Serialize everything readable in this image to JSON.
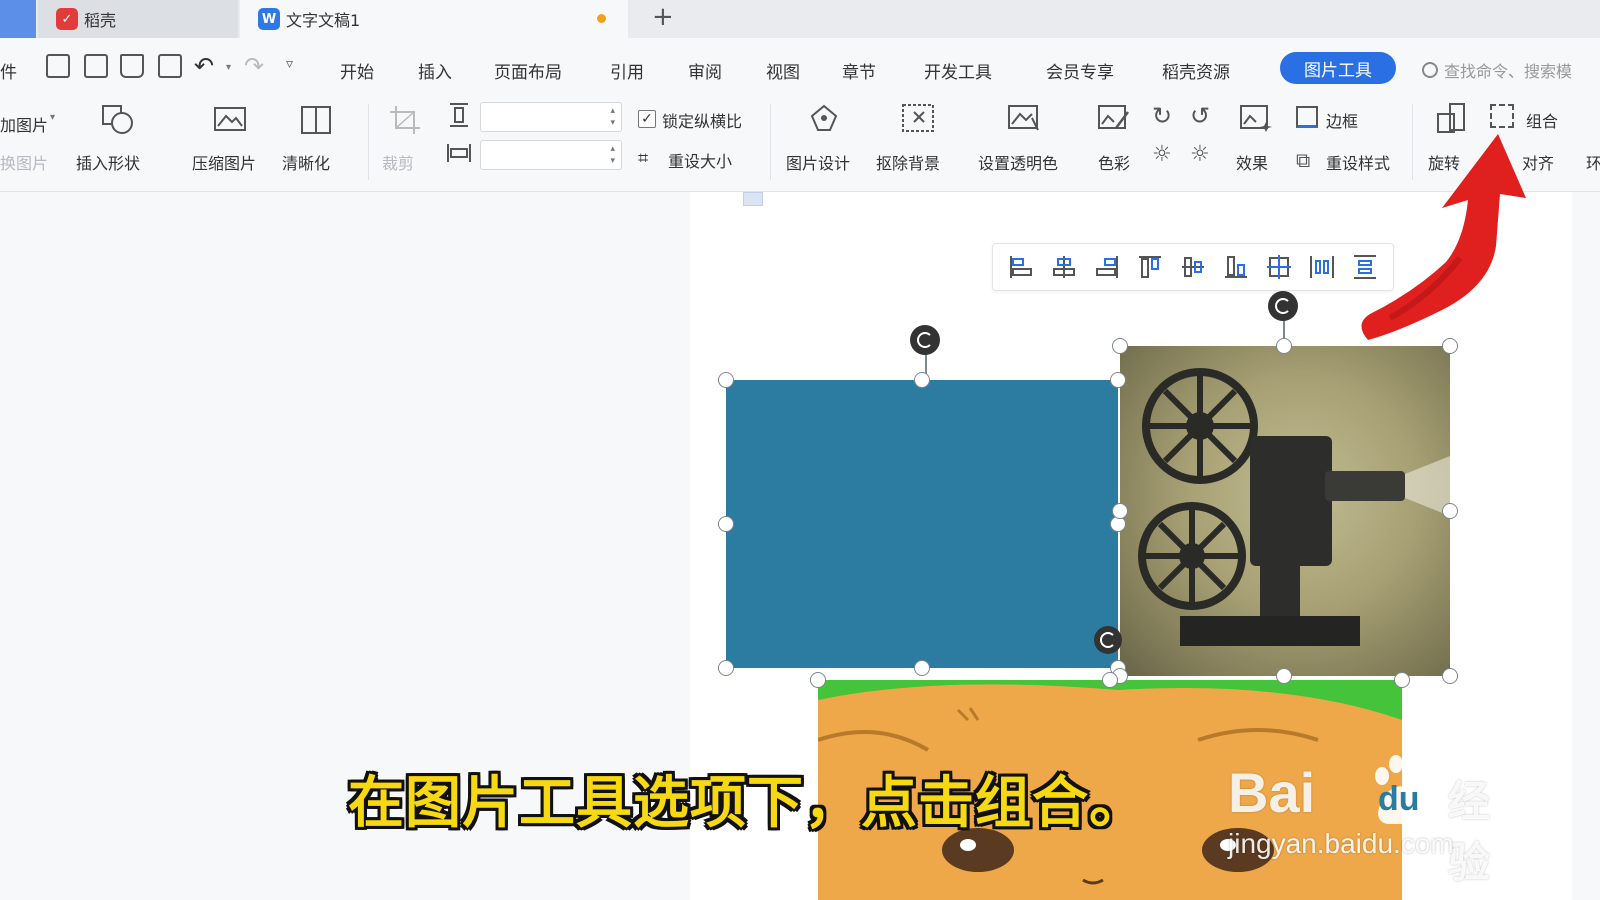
{
  "tabs": {
    "docer_label": "稻壳",
    "doc_label": "文字文稿1",
    "add_label": "+"
  },
  "menu": {
    "file_fragment": "件",
    "items": [
      "开始",
      "插入",
      "页面布局",
      "引用",
      "审阅",
      "视图",
      "章节",
      "开发工具",
      "会员专享",
      "稻壳资源"
    ],
    "active_tab": "图片工具",
    "search_placeholder": "查找命令、搜索模"
  },
  "ribbon": {
    "add_picture": "加图片",
    "change_picture": "换图片",
    "insert_shape": "插入形状",
    "compress": "压缩图片",
    "sharpen": "清晰化",
    "crop": "裁剪",
    "lock_ratio": "锁定纵横比",
    "reset_size": "重设大小",
    "picture_design": "图片设计",
    "remove_bg": "抠除背景",
    "set_transparent": "设置透明色",
    "color": "色彩",
    "effects": "效果",
    "border": "边框",
    "reset_style": "重设样式",
    "rotate": "旋转",
    "group": "组合",
    "align": "对齐",
    "wrap_fragment": "环"
  },
  "caption": {
    "text": "在图片工具选项下，点击组合。"
  },
  "watermark": {
    "brand": "Bai",
    "brand_du": "du",
    "jingyan": "经验",
    "url": "jingyan.baidu.com"
  },
  "colors": {
    "accent": "#2b6fe5",
    "shape_fill": "#2c7ba0",
    "caption_yellow": "#f6d913",
    "arrow_red": "#e01f1f"
  }
}
